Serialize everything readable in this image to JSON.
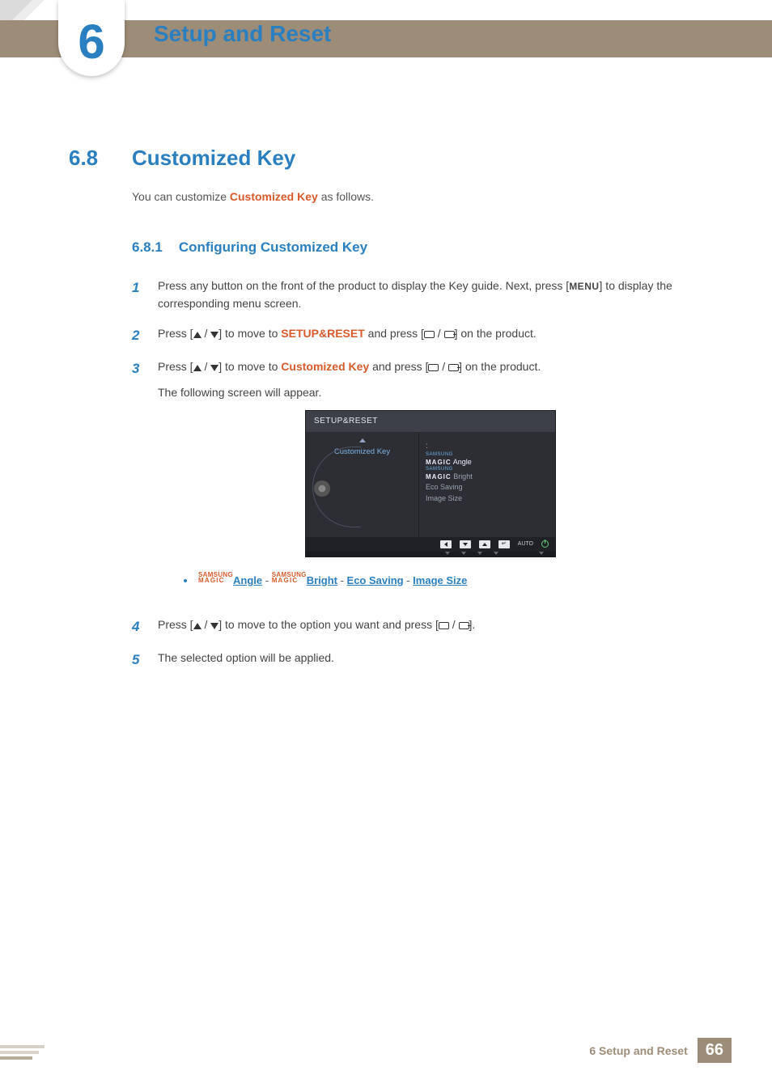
{
  "chapter": {
    "number": "6",
    "title": "Setup and Reset"
  },
  "section": {
    "number": "6.8",
    "title": "Customized Key"
  },
  "intro": {
    "pre": "You can customize ",
    "highlight": "Customized Key",
    "post": " as follows."
  },
  "subsection": {
    "number": "6.8.1",
    "title": "Configuring Customized Key"
  },
  "steps": {
    "s1": {
      "num": "1",
      "a": "Press any button on the front of the product to display the Key guide. Next, press [",
      "menu": "MENU",
      "b": "] to display the corresponding menu screen."
    },
    "s2": {
      "num": "2",
      "a": "Press [",
      "b": "] to move to ",
      "target": "SETUP&RESET",
      "c": " and press [",
      "d": "] on the product."
    },
    "s3": {
      "num": "3",
      "a": "Press [",
      "b": "] to move to ",
      "target": "Customized Key",
      "c": " and press [",
      "d": "] on the product.",
      "follow": "The following screen will appear."
    },
    "s4": {
      "num": "4",
      "a": "Press [",
      "b": "] to move to the option you want and press [",
      "c": "]."
    },
    "s5": {
      "num": "5",
      "a": "The selected option will be applied."
    }
  },
  "osd": {
    "title": "SETUP&RESET",
    "selected": "Customized Key",
    "colon": ":",
    "opts": {
      "angle_brand1": "SAMSUNG",
      "angle_brand2": "MAGIC",
      "angle": "Angle",
      "bright_brand1": "SAMSUNG",
      "bright_brand2": "MAGIC",
      "bright": "Bright",
      "eco": "Eco Saving",
      "size": "Image Size"
    },
    "auto": "AUTO"
  },
  "options_line": {
    "m1a": "SAMSUNG",
    "m1b": "MAGIC",
    "angle": "Angle",
    "sep": " - ",
    "m2a": "SAMSUNG",
    "m2b": "MAGIC",
    "bright": "Bright",
    "eco": "Eco Saving",
    "size": "Image Size"
  },
  "footer": {
    "chapter_label": "6 Setup and Reset",
    "page": "66"
  }
}
